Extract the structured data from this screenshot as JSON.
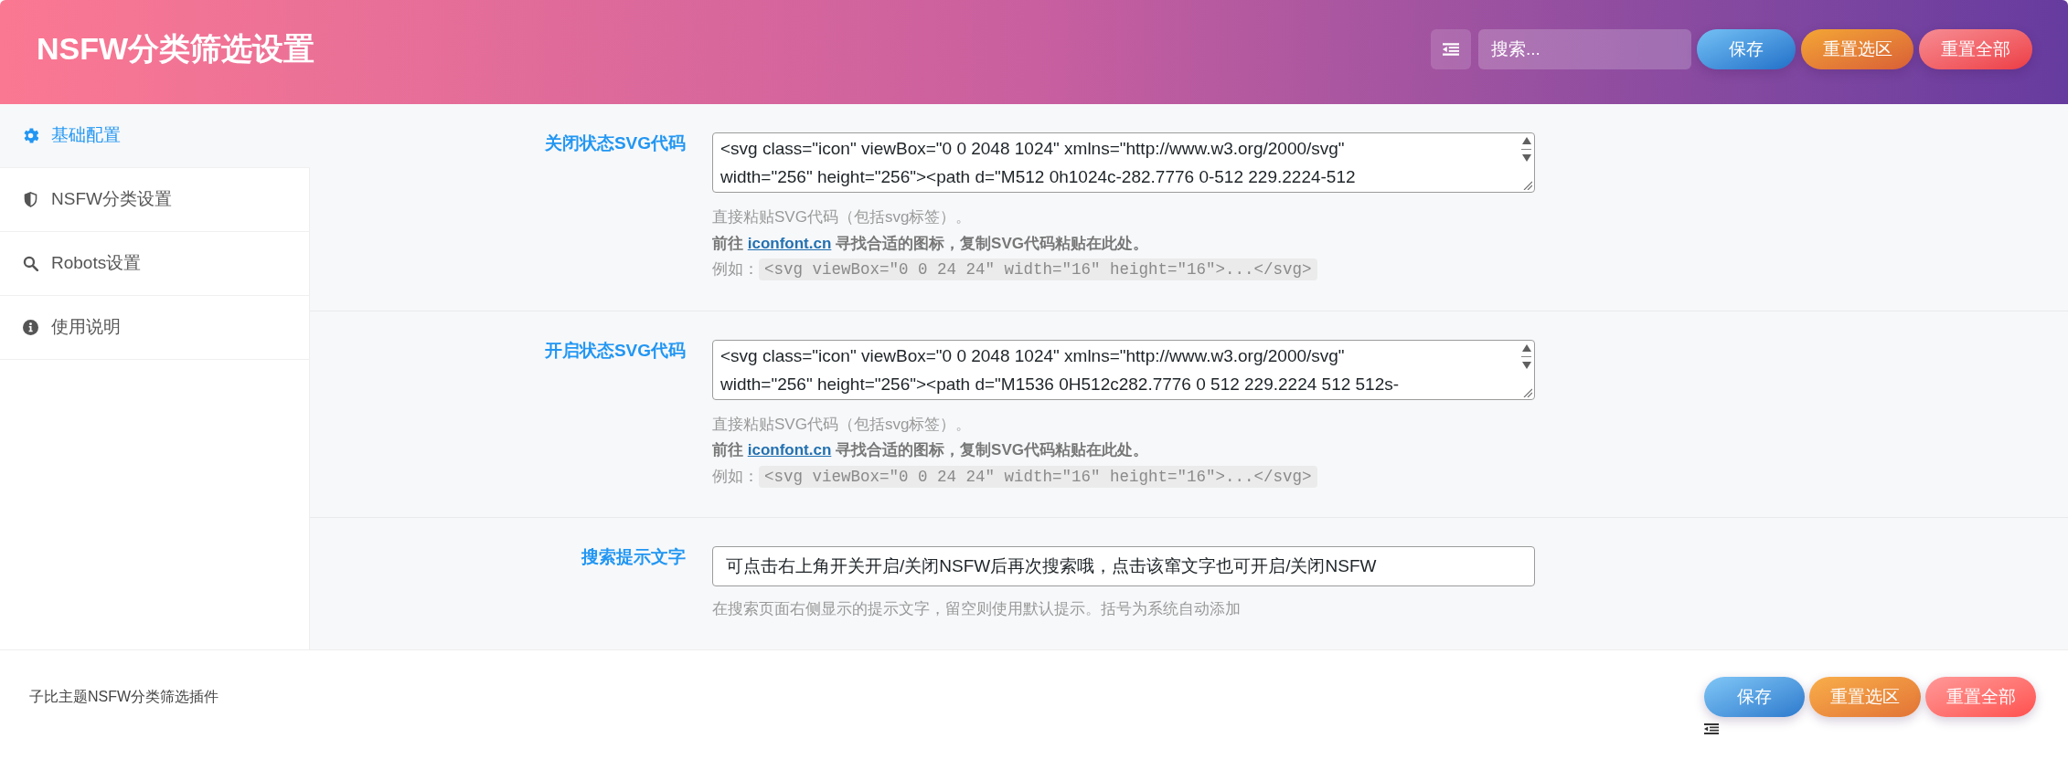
{
  "header": {
    "title": "NSFW分类筛选设置",
    "search": {
      "placeholder": "搜索..."
    },
    "buttons": [
      {
        "kind": "save",
        "label": "保存"
      },
      {
        "kind": "reset_section",
        "label": "重置选区"
      },
      {
        "kind": "reset_all",
        "label": "重置全部"
      }
    ]
  },
  "sidebar": {
    "items": [
      {
        "label": "基础配置",
        "selected": true
      },
      {
        "label": "NSFW分类设置",
        "selected": false
      },
      {
        "label": "Robots设置",
        "selected": false
      },
      {
        "label": "使用说明",
        "selected": false
      }
    ]
  },
  "fields": [
    {
      "kind": "code",
      "label": "关闭状态SVG代码",
      "lines": [
        "<svg class=\"icon\" viewBox=\"0 0 2048 1024\" xmlns=\"http://www.w3.org/2000/svg\"",
        "width=\"256\" height=\"256\"><path d=\"M512 0h1024c-282.7776 0-512 229.2224-512"
      ],
      "hint": "直接粘贴SVG代码（包括svg标签）。",
      "link_line": {
        "before": "前往 ",
        "link": "iconfont.cn",
        "after": " 寻找合适的图标，复制SVG代码粘贴在此处。"
      },
      "example": {
        "label": "例如：",
        "code": "<svg viewBox=\"0 0 24 24\" width=\"16\" height=\"16\">...</svg>"
      }
    },
    {
      "kind": "code",
      "label": "开启状态SVG代码",
      "lines": [
        "<svg class=\"icon\" viewBox=\"0 0 2048 1024\" xmlns=\"http://www.w3.org/2000/svg\"",
        "width=\"256\" height=\"256\"><path d=\"M1536 0H512c282.7776 0 512 229.2224 512 512s-"
      ],
      "hint": "直接粘贴SVG代码（包括svg标签）。",
      "link_line": {
        "before": "前往 ",
        "link": "iconfont.cn",
        "after": " 寻找合适的图标，复制SVG代码粘贴在此处。"
      },
      "example": {
        "label": "例如：",
        "code": "<svg viewBox=\"0 0 24 24\" width=\"16\" height=\"16\">...</svg>"
      }
    },
    {
      "kind": "text",
      "label": "搜索提示文字",
      "value": "可点击右上角开关开启/关闭NSFW后再次搜索哦，点击该窜文字也可开启/关闭NSFW",
      "hint": "在搜索页面右侧显示的提示文字，留空则使用默认提示。括号为系统自动添加"
    }
  ],
  "footer": {
    "text": "子比主题NSFW分类筛选插件",
    "buttons": [
      {
        "kind": "save",
        "label": "保存"
      },
      {
        "kind": "reset_section",
        "label": "重置选区"
      },
      {
        "kind": "reset_all",
        "label": "重置全部"
      }
    ]
  }
}
